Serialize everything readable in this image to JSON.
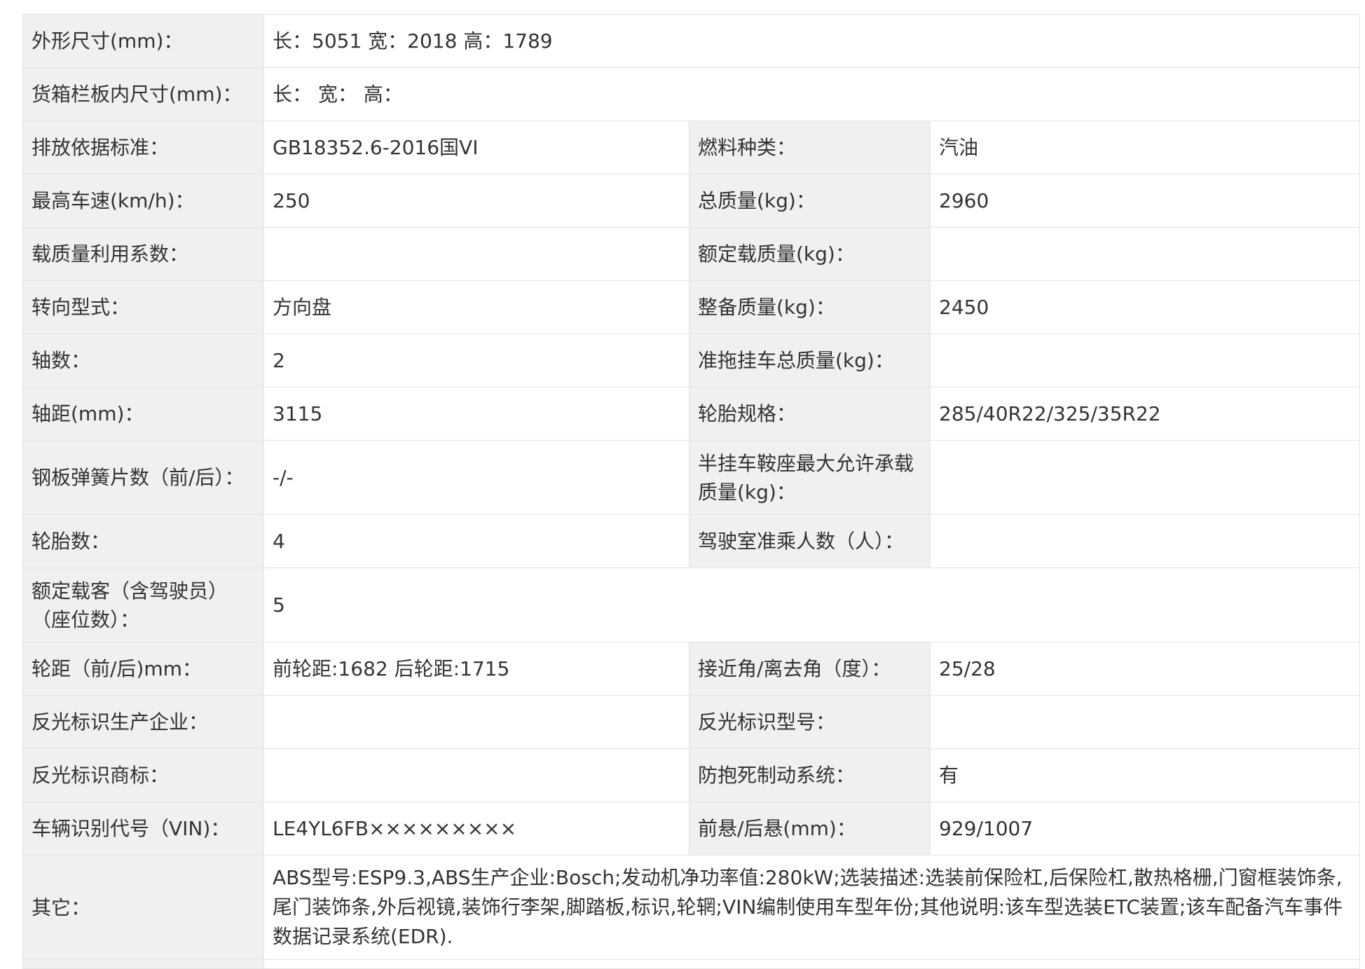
{
  "rows": {
    "dimensions": {
      "label": "外形尺寸(mm)：",
      "value": "长：5051 宽：2018 高：1789"
    },
    "cargo_box": {
      "label": "货箱栏板内尺寸(mm)：",
      "value": "长：  宽：  高："
    },
    "emission": {
      "label": "排放依据标准：",
      "value": "GB18352.6-2016国VI"
    },
    "fuel": {
      "label": "燃料种类：",
      "value": "汽油"
    },
    "max_speed": {
      "label": "最高车速(km/h)：",
      "value": "250"
    },
    "total_mass": {
      "label": "总质量(kg)：",
      "value": "2960"
    },
    "load_factor": {
      "label": "载质量利用系数：",
      "value": ""
    },
    "rated_load": {
      "label": "额定载质量(kg)：",
      "value": ""
    },
    "steering": {
      "label": "转向型式：",
      "value": "方向盘"
    },
    "curb_mass": {
      "label": "整备质量(kg)：",
      "value": "2450"
    },
    "axles": {
      "label": "轴数：",
      "value": "2"
    },
    "trailer_mass": {
      "label": "准拖挂车总质量(kg)：",
      "value": ""
    },
    "wheelbase": {
      "label": "轴距(mm)：",
      "value": "3115"
    },
    "tire_spec": {
      "label": "轮胎规格：",
      "value": "285/40R22/325/35R22"
    },
    "leaf_springs": {
      "label": "钢板弹簧片数（前/后）：",
      "value": "-/-"
    },
    "saddle_load": {
      "label": "半挂车鞍座最大允许承载质量(kg)：",
      "value": ""
    },
    "tire_count": {
      "label": "轮胎数：",
      "value": "4"
    },
    "cab_passengers": {
      "label": "驾驶室准乘人数（人）：",
      "value": ""
    },
    "rated_passengers": {
      "label": "额定载客（含驾驶员）（座位数）：",
      "value": "5"
    },
    "track": {
      "label": "轮距（前/后)mm：",
      "value": "前轮距:1682 后轮距:1715"
    },
    "angles": {
      "label": "接近角/离去角（度）：",
      "value": "25/28"
    },
    "reflector_maker": {
      "label": "反光标识生产企业：",
      "value": ""
    },
    "reflector_model": {
      "label": "反光标识型号：",
      "value": ""
    },
    "reflector_brand": {
      "label": "反光标识商标：",
      "value": ""
    },
    "abs": {
      "label": "防抱死制动系统：",
      "value": "有"
    },
    "vin": {
      "label": "车辆识别代号（VIN)：",
      "value": "LE4YL6FB×××××××××"
    },
    "overhang": {
      "label": "前悬/后悬(mm)：",
      "value": "929/1007"
    },
    "other": {
      "label": "其它：",
      "value": "ABS型号:ESP9.3,ABS生产企业:Bosch;发动机净功率值:280kW;选装描述:选装前保险杠,后保险杠,散热格栅,门窗框装饰条,尾门装饰条,外后视镜,装饰行李架,脚踏板,标识,轮辋;VIN编制使用车型年份;其他说明:该车型选装ETC装置;该车配备汽车事件数据记录系统(EDR)."
    }
  }
}
